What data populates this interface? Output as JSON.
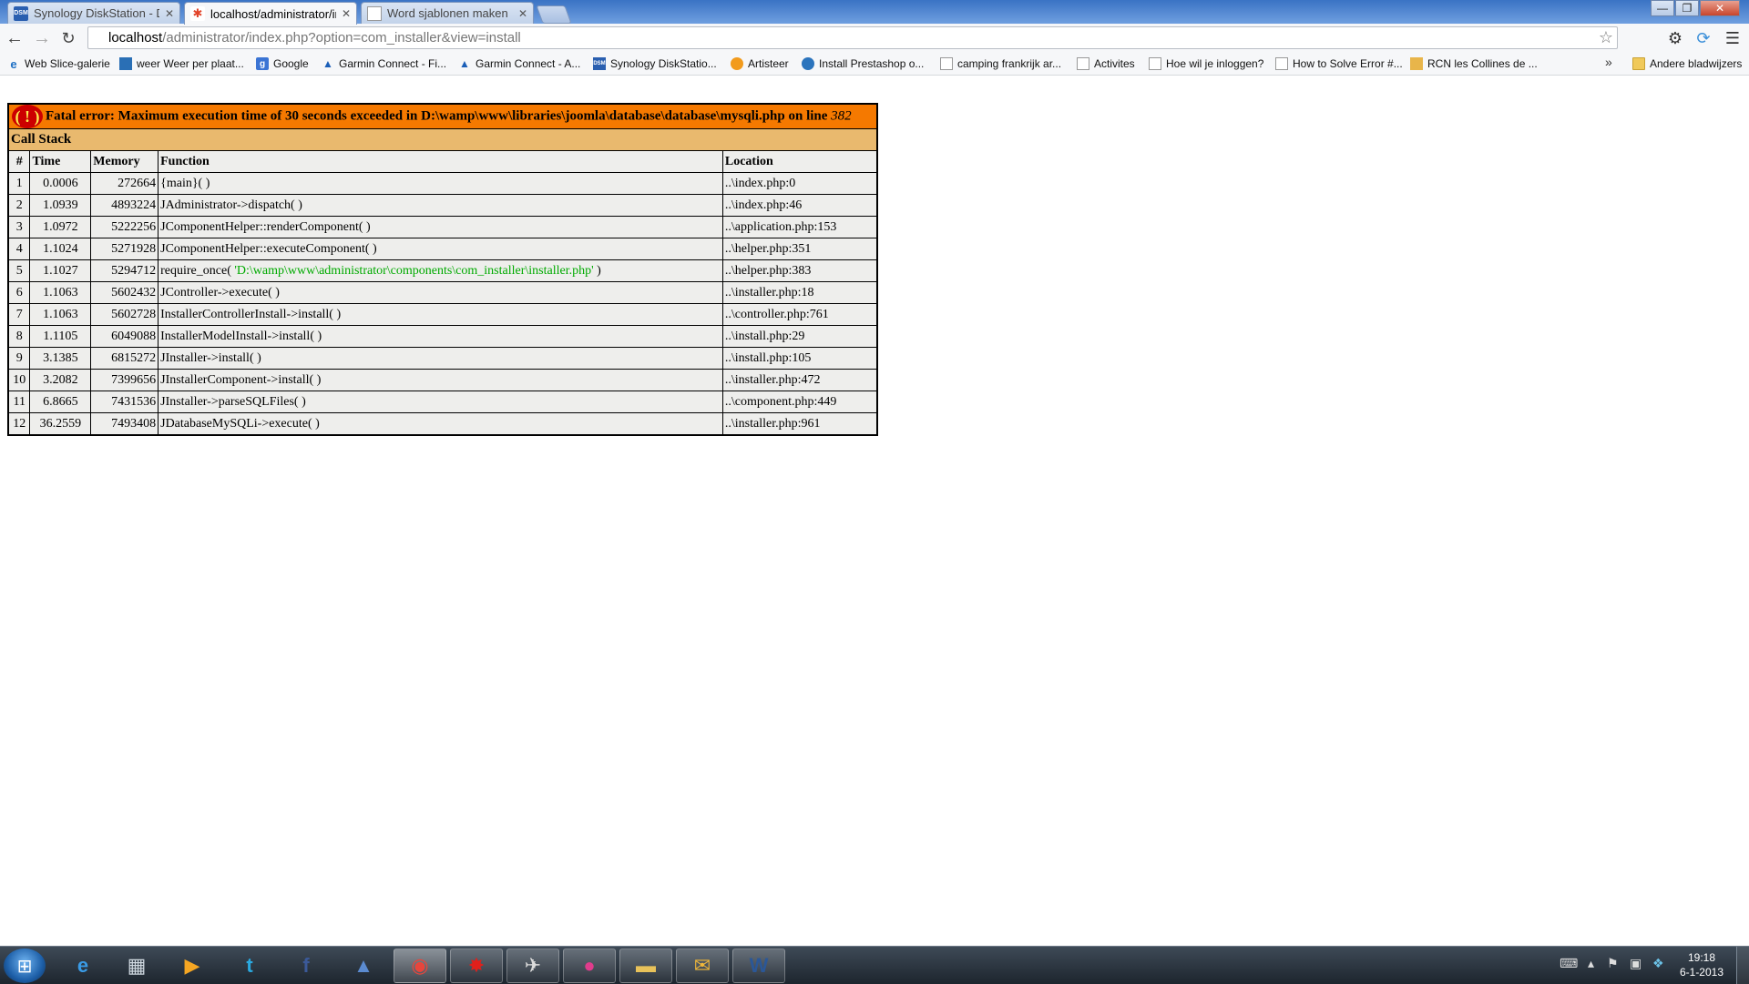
{
  "tabs": [
    {
      "title": "Synology DiskStation - Di",
      "favicon": "dsm-icon",
      "active": false
    },
    {
      "title": "localhost/administrator/ir",
      "favicon": "joomla-icon",
      "active": true
    },
    {
      "title": "Word sjablonen maken",
      "favicon": "page-icon",
      "active": false
    }
  ],
  "window_controls": {
    "minimize": "—",
    "maximize": "❐",
    "close": "✕"
  },
  "address_bar": {
    "host": "localhost",
    "path": "/administrator/index.php?option=com_installer&view=install"
  },
  "bookmarks": [
    {
      "label": "Web Slice-galerie",
      "icon": "ie-icon"
    },
    {
      "label": "weer Weer per plaat...",
      "icon": "weather-icon"
    },
    {
      "label": "Google",
      "icon": "google-icon"
    },
    {
      "label": "Garmin Connect - Fi...",
      "icon": "garmin-icon"
    },
    {
      "label": "Garmin Connect - A...",
      "icon": "garmin-icon"
    },
    {
      "label": "Synology DiskStatio...",
      "icon": "dsm-icon"
    },
    {
      "label": "Artisteer",
      "icon": "artisteer-icon"
    },
    {
      "label": "Install Prestashop o...",
      "icon": "prestashop-icon"
    },
    {
      "label": "camping frankrijk ar...",
      "icon": "page-icon"
    },
    {
      "label": "Activites",
      "icon": "page-icon"
    },
    {
      "label": "Hoe wil je inloggen?",
      "icon": "page-icon"
    },
    {
      "label": "How to Solve Error #...",
      "icon": "page-icon"
    },
    {
      "label": "RCN les Collines de ...",
      "icon": "rcn-icon"
    }
  ],
  "other_bookmarks": "Andere bladwijzers",
  "error": {
    "icon_text": "( ! )",
    "message": "Fatal error: Maximum execution time of 30 seconds exceeded in D:\\wamp\\www\\libraries\\joomla\\database\\database\\mysqli.php on line ",
    "line": "382"
  },
  "call_stack": {
    "title": "Call Stack",
    "headers": [
      "#",
      "Time",
      "Memory",
      "Function",
      "Location"
    ],
    "rows": [
      {
        "n": "1",
        "time": "0.0006",
        "memory": "272664",
        "function": "{main}( )",
        "arg": "",
        "function_end": "",
        "location": "..\\index.php:0"
      },
      {
        "n": "2",
        "time": "1.0939",
        "memory": "4893224",
        "function": "JAdministrator->dispatch( )",
        "arg": "",
        "function_end": "",
        "location": "..\\index.php:46"
      },
      {
        "n": "3",
        "time": "1.0972",
        "memory": "5222256",
        "function": "JComponentHelper::renderComponent( )",
        "arg": "",
        "function_end": "",
        "location": "..\\application.php:153"
      },
      {
        "n": "4",
        "time": "1.1024",
        "memory": "5271928",
        "function": "JComponentHelper::executeComponent( )",
        "arg": "",
        "function_end": "",
        "location": "..\\helper.php:351"
      },
      {
        "n": "5",
        "time": "1.1027",
        "memory": "5294712",
        "function": "require_once( ",
        "arg": "'D:\\wamp\\www\\administrator\\components\\com_installer\\installer.php'",
        "function_end": " )",
        "location": "..\\helper.php:383"
      },
      {
        "n": "6",
        "time": "1.1063",
        "memory": "5602432",
        "function": "JController->execute( )",
        "arg": "",
        "function_end": "",
        "location": "..\\installer.php:18"
      },
      {
        "n": "7",
        "time": "1.1063",
        "memory": "5602728",
        "function": "InstallerControllerInstall->install( )",
        "arg": "",
        "function_end": "",
        "location": "..\\controller.php:761"
      },
      {
        "n": "8",
        "time": "1.1105",
        "memory": "6049088",
        "function": "InstallerModelInstall->install( )",
        "arg": "",
        "function_end": "",
        "location": "..\\install.php:29"
      },
      {
        "n": "9",
        "time": "3.1385",
        "memory": "6815272",
        "function": "JInstaller->install( )",
        "arg": "",
        "function_end": "",
        "location": "..\\install.php:105"
      },
      {
        "n": "10",
        "time": "3.2082",
        "memory": "7399656",
        "function": "JInstallerComponent->install( )",
        "arg": "",
        "function_end": "",
        "location": "..\\installer.php:472"
      },
      {
        "n": "11",
        "time": "6.8665",
        "memory": "7431536",
        "function": "JInstaller->parseSQLFiles( )",
        "arg": "",
        "function_end": "",
        "location": "..\\component.php:449"
      },
      {
        "n": "12",
        "time": "36.2559",
        "memory": "7493408",
        "function": "JDatabaseMySQLi->execute( )",
        "arg": "",
        "function_end": "",
        "location": "..\\installer.php:961"
      }
    ]
  },
  "taskbar": {
    "apps": [
      {
        "name": "internet-explorer",
        "glyph": "e",
        "color": "#3a9be6",
        "active": false,
        "running": false
      },
      {
        "name": "calculator",
        "glyph": "▦",
        "color": "#cfd8e0",
        "active": false,
        "running": false
      },
      {
        "name": "media-player",
        "glyph": "▶",
        "color": "#f5a623",
        "active": false,
        "running": false
      },
      {
        "name": "twitter",
        "glyph": "t",
        "color": "#2aa9e0",
        "active": false,
        "running": false
      },
      {
        "name": "facebook",
        "glyph": "f",
        "color": "#3b5998",
        "active": false,
        "running": false
      },
      {
        "name": "garmin",
        "glyph": "▲",
        "color": "#5b8bd0",
        "active": false,
        "running": false
      },
      {
        "name": "chrome",
        "glyph": "◉",
        "color": "#e8453c",
        "active": true,
        "running": true
      },
      {
        "name": "paint-splash",
        "glyph": "✸",
        "color": "#e0201b",
        "active": false,
        "running": true
      },
      {
        "name": "network-tool",
        "glyph": "✈",
        "color": "#dcdcdc",
        "active": false,
        "running": true
      },
      {
        "name": "app-pink",
        "glyph": "●",
        "color": "#e03c8c",
        "active": false,
        "running": true
      },
      {
        "name": "windows-explorer",
        "glyph": "▬",
        "color": "#e8c25a",
        "active": false,
        "running": true
      },
      {
        "name": "outlook",
        "glyph": "✉",
        "color": "#f0b73a",
        "active": false,
        "running": true
      },
      {
        "name": "word",
        "glyph": "W",
        "color": "#2b5797",
        "active": false,
        "running": true
      }
    ],
    "time": "19:18",
    "date": "6-1-2013"
  }
}
